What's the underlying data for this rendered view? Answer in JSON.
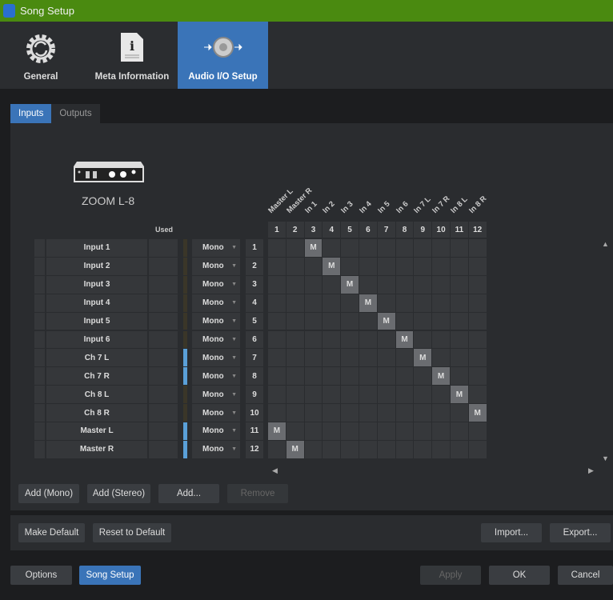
{
  "window": {
    "title": "Song Setup"
  },
  "nav": {
    "tabs": [
      {
        "label": "General"
      },
      {
        "label": "Meta Information"
      },
      {
        "label": "Audio I/O Setup",
        "active": true
      }
    ]
  },
  "subtabs": {
    "inputs": "Inputs",
    "outputs": "Outputs",
    "active": "Inputs"
  },
  "device": {
    "name": "ZOOM L-8"
  },
  "matrix": {
    "used_label": "Used",
    "column_headers": [
      "Master L",
      "Master R",
      "In 1",
      "In 2",
      "In 3",
      "In 4",
      "In 5",
      "In 6",
      "In 7 L",
      "In 7 R",
      "In 8 L",
      "In 8 R"
    ],
    "column_numbers": [
      "1",
      "2",
      "3",
      "4",
      "5",
      "6",
      "7",
      "8",
      "9",
      "10",
      "11",
      "12"
    ],
    "rows": [
      {
        "name": "Input 1",
        "mode": "Mono",
        "num": "1",
        "used": false,
        "m_col": 3
      },
      {
        "name": "Input 2",
        "mode": "Mono",
        "num": "2",
        "used": false,
        "m_col": 4
      },
      {
        "name": "Input 3",
        "mode": "Mono",
        "num": "3",
        "used": false,
        "m_col": 5
      },
      {
        "name": "Input 4",
        "mode": "Mono",
        "num": "4",
        "used": false,
        "m_col": 6
      },
      {
        "name": "Input 5",
        "mode": "Mono",
        "num": "5",
        "used": false,
        "m_col": 7
      },
      {
        "name": "Input 6",
        "mode": "Mono",
        "num": "6",
        "used": false,
        "m_col": 8
      },
      {
        "name": "Ch 7 L",
        "mode": "Mono",
        "num": "7",
        "used": true,
        "m_col": 9
      },
      {
        "name": "Ch 7 R",
        "mode": "Mono",
        "num": "8",
        "used": true,
        "m_col": 10
      },
      {
        "name": "Ch 8 L",
        "mode": "Mono",
        "num": "9",
        "used": false,
        "m_col": 11
      },
      {
        "name": "Ch 8 R",
        "mode": "Mono",
        "num": "10",
        "used": false,
        "m_col": 12
      },
      {
        "name": "Master L",
        "mode": "Mono",
        "num": "11",
        "used": true,
        "m_col": 1
      },
      {
        "name": "Master R",
        "mode": "Mono",
        "num": "12",
        "used": true,
        "m_col": 2
      }
    ],
    "mark": "M"
  },
  "buttons": {
    "add_mono": "Add (Mono)",
    "add_stereo": "Add (Stereo)",
    "add": "Add...",
    "remove": "Remove",
    "make_default": "Make Default",
    "reset_default": "Reset to Default",
    "import": "Import...",
    "export": "Export...",
    "options": "Options",
    "song_setup": "Song Setup",
    "apply": "Apply",
    "ok": "OK",
    "cancel": "Cancel"
  },
  "colors": {
    "accent": "#3a74b8",
    "titlebar": "#4a8a10",
    "used": "#5aa0d8",
    "unused": "#3a3628"
  }
}
